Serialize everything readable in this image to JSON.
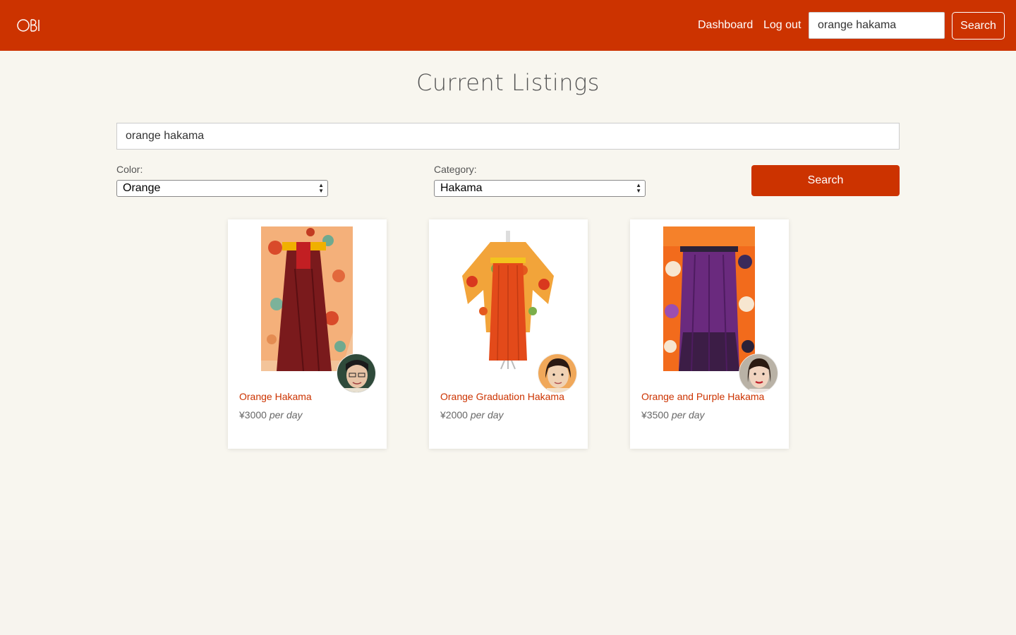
{
  "nav": {
    "logo_text": "OBI",
    "dashboard_label": "Dashboard",
    "logout_label": "Log out",
    "search_value": "orange hakama",
    "search_button_label": "Search"
  },
  "page": {
    "title": "Current Listings"
  },
  "search": {
    "query": "orange hakama",
    "color_label": "Color:",
    "color_selected": "Orange",
    "category_label": "Category:",
    "category_selected": "Hakama",
    "button_label": "Search"
  },
  "listings": [
    {
      "title": "Orange Hakama",
      "price": "¥3000",
      "unit": "per day"
    },
    {
      "title": "Orange Graduation Hakama",
      "price": "¥2000",
      "unit": "per day"
    },
    {
      "title": "Orange and Purple Hakama",
      "price": "¥3500",
      "unit": "per day"
    }
  ],
  "colors": {
    "brand": "#cc3300",
    "background": "#f8f6ef"
  }
}
